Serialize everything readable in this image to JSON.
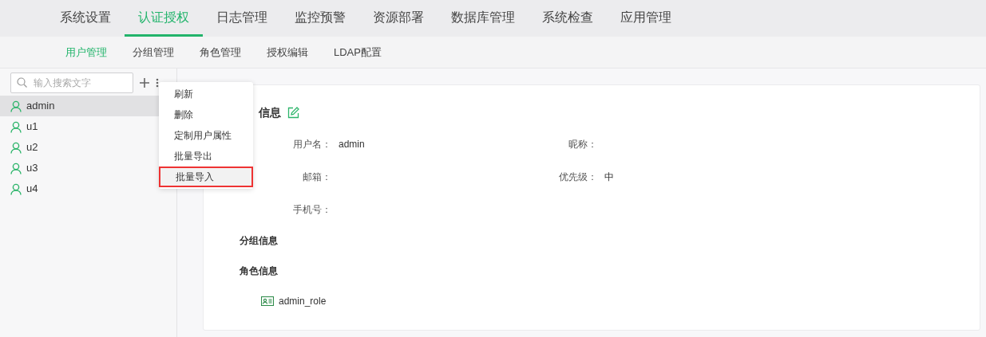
{
  "top_tabs": [
    {
      "label": "系统设置",
      "selected": false
    },
    {
      "label": "认证授权",
      "selected": true
    },
    {
      "label": "日志管理",
      "selected": false
    },
    {
      "label": "监控预警",
      "selected": false
    },
    {
      "label": "资源部署",
      "selected": false
    },
    {
      "label": "数据库管理",
      "selected": false
    },
    {
      "label": "系统检查",
      "selected": false
    },
    {
      "label": "应用管理",
      "selected": false
    }
  ],
  "sub_tabs": [
    {
      "label": "用户管理",
      "selected": true
    },
    {
      "label": "分组管理",
      "selected": false
    },
    {
      "label": "角色管理",
      "selected": false
    },
    {
      "label": "授权编辑",
      "selected": false
    },
    {
      "label": "LDAP配置",
      "selected": false
    }
  ],
  "sidebar": {
    "search": {
      "placeholder": "输入搜索文字"
    },
    "users": [
      {
        "name": "admin",
        "selected": true
      },
      {
        "name": "u1",
        "selected": false
      },
      {
        "name": "u2",
        "selected": false
      },
      {
        "name": "u3",
        "selected": false
      },
      {
        "name": "u4",
        "selected": false
      }
    ]
  },
  "context_menu": [
    {
      "label": "刷新",
      "highlighted": false
    },
    {
      "label": "删除",
      "highlighted": false
    },
    {
      "label": "定制用户属性",
      "highlighted": false
    },
    {
      "label": "批量导出",
      "highlighted": false
    },
    {
      "label": "批量导入",
      "highlighted": true
    }
  ],
  "user_info": {
    "title": "信息",
    "rows": [
      [
        {
          "label": "用户名：",
          "value": "admin"
        },
        {
          "label": "昵称："
        }
      ],
      [
        {
          "label": "邮箱："
        },
        {
          "label": "优先级：",
          "value": "中"
        }
      ],
      [
        {
          "label": "手机号："
        }
      ]
    ]
  },
  "group_info": {
    "title": "分组信息"
  },
  "role_info": {
    "title": "角色信息",
    "roles": [
      "admin_role"
    ]
  }
}
